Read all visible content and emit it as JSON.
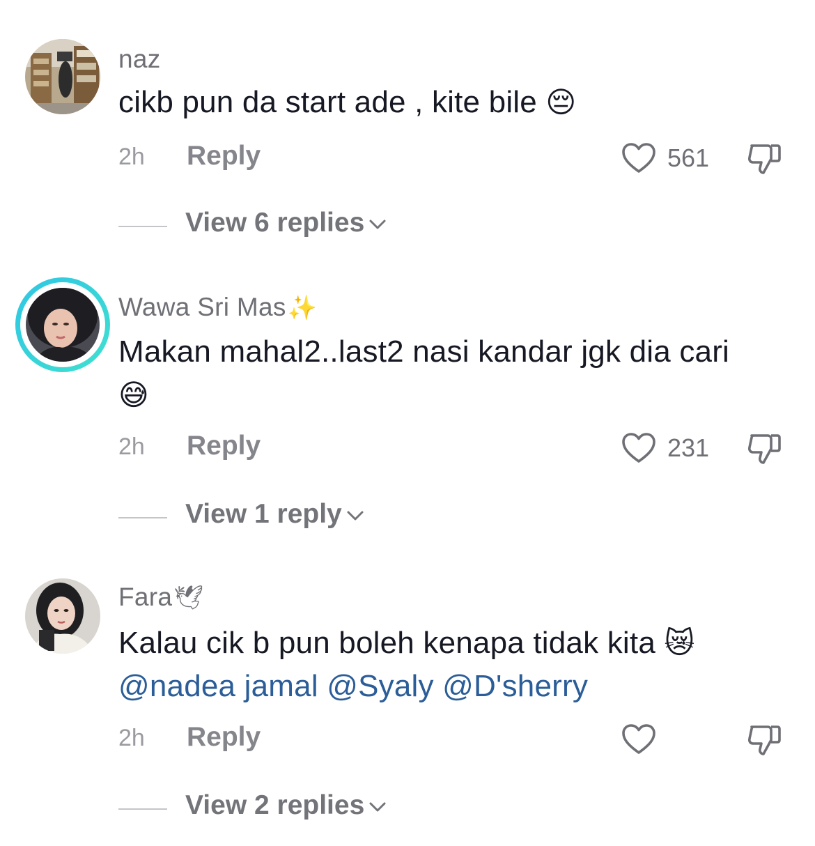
{
  "comments": [
    {
      "username": "naz",
      "username_deco": "",
      "text": "cikb pun da start ade , kite bile",
      "text_emoji": "😔",
      "time": "2h",
      "reply_label": "Reply",
      "likes": "561",
      "view_replies_label": "View 6 replies",
      "avatar_story_ring": false
    },
    {
      "username": "Wawa Sri Mas",
      "username_deco": "✨",
      "text": "Makan mahal2..last2 nasi kandar jgk dia cari",
      "text_emoji": "😅",
      "time": "2h",
      "reply_label": "Reply",
      "likes": "231",
      "view_replies_label": "View 1 reply",
      "avatar_story_ring": true
    },
    {
      "username": "Fara",
      "username_deco": "🕊",
      "text": "Kalau cik b pun boleh kenapa tidak kita",
      "text_emoji": "😿",
      "mentions": [
        "@nadea jamal",
        "@Syaly",
        "@D'sherry"
      ],
      "time": "2h",
      "reply_label": "Reply",
      "likes": "",
      "view_replies_label": "View 2 replies",
      "avatar_story_ring": false
    }
  ],
  "colors": {
    "text": "#161823",
    "secondary": "#6f7076",
    "mention": "#2b5d98",
    "story_ring": "#2fc6e4"
  },
  "icons": [
    "heart-outline-icon",
    "thumbs-down-outline-icon",
    "chevron-down-icon"
  ]
}
